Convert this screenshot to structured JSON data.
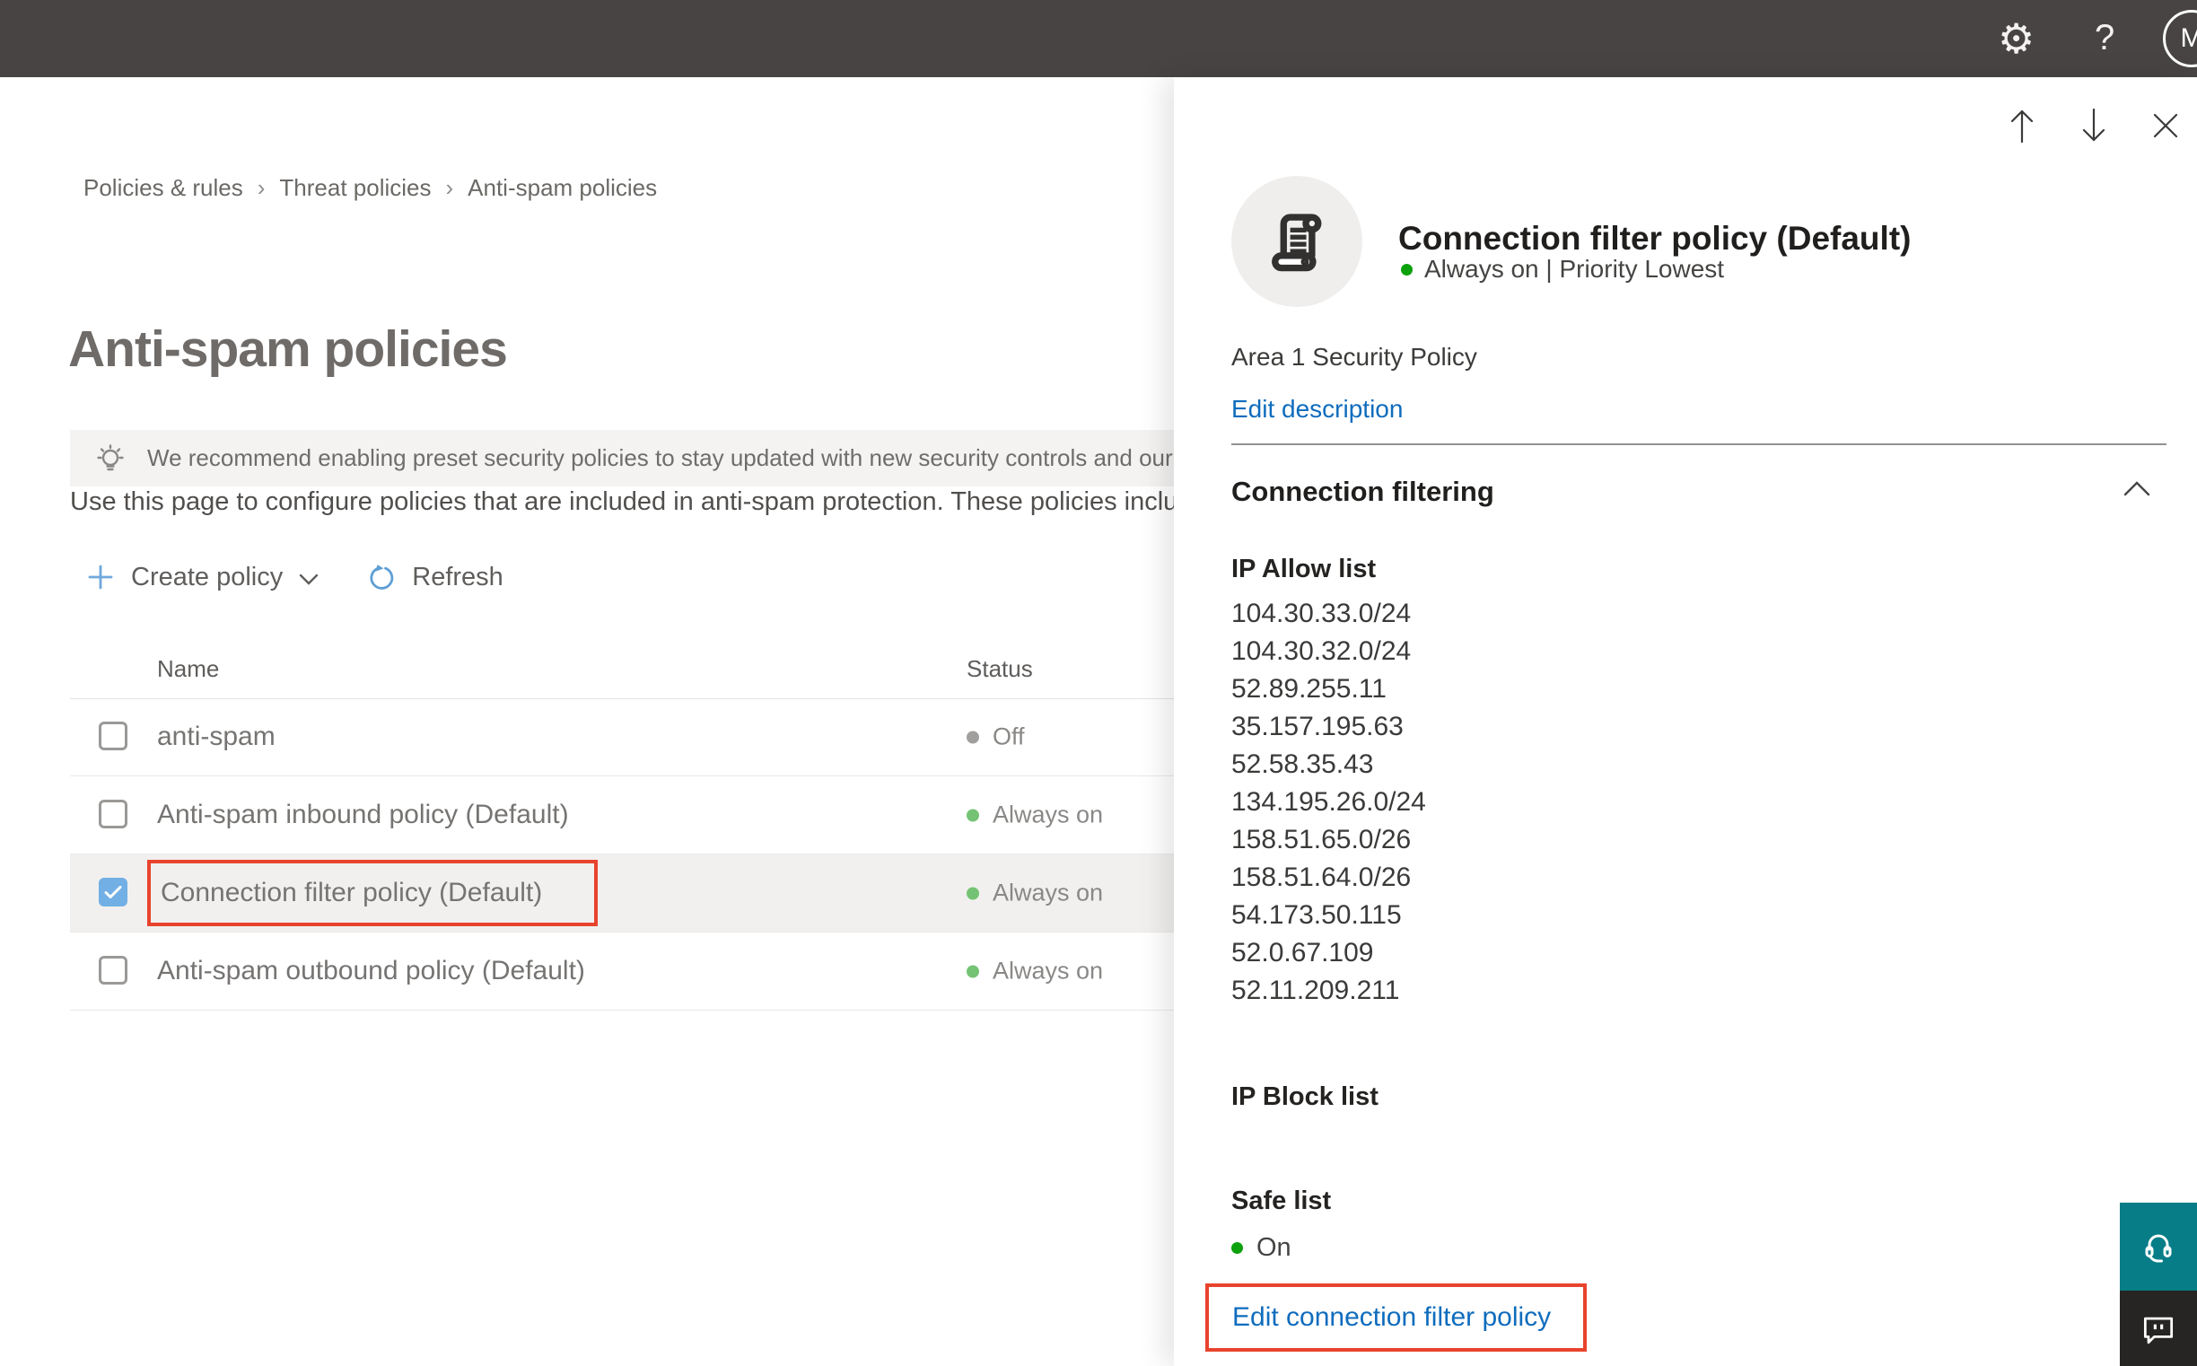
{
  "topbar": {
    "avatar_initial": "M"
  },
  "breadcrumb": {
    "items": [
      "Policies & rules",
      "Threat policies",
      "Anti-spam policies"
    ]
  },
  "page": {
    "title": "Anti-spam policies",
    "banner_text": "We recommend enabling preset security policies to stay updated with new security controls and our recommendations",
    "description": "Use this page to configure policies that are included in anti-spam protection. These policies include"
  },
  "toolbar": {
    "create_policy": "Create policy",
    "refresh": "Refresh"
  },
  "table": {
    "columns": {
      "name": "Name",
      "status": "Status"
    },
    "rows": [
      {
        "name": "anti-spam",
        "status": "Off",
        "checked": false,
        "selected": false
      },
      {
        "name": "Anti-spam inbound policy (Default)",
        "status": "Always on",
        "checked": false,
        "selected": false
      },
      {
        "name": "Connection filter policy (Default)",
        "status": "Always on",
        "checked": true,
        "selected": true
      },
      {
        "name": "Anti-spam outbound policy (Default)",
        "status": "Always on",
        "checked": false,
        "selected": false
      }
    ]
  },
  "flyout": {
    "title": "Connection filter policy (Default)",
    "status_line": "Always on | Priority Lowest",
    "description": "Area 1 Security Policy",
    "edit_description_link": "Edit description",
    "section_title": "Connection filtering",
    "ip_allow_title": "IP Allow list",
    "ip_allow_list": [
      "104.30.33.0/24",
      "104.30.32.0/24",
      "52.89.255.11",
      "35.157.195.63",
      "52.58.35.43",
      "134.195.26.0/24",
      "158.51.65.0/26",
      "158.51.64.0/26",
      "54.173.50.115",
      "52.0.67.109",
      "52.11.209.211"
    ],
    "ip_block_title": "IP Block list",
    "safe_list_title": "Safe list",
    "safe_list_status": "On",
    "edit_policy_link": "Edit connection filter policy"
  },
  "colors": {
    "topbar_bg": "#474443",
    "accent_blue": "#0f6cbd",
    "highlight_red": "#e8432d",
    "status_green_bright": "#0da10d",
    "status_green_soft": "#74c374",
    "status_gray": "#a19f9d",
    "checkbox_checked": "#71afe5",
    "teal_button": "#077d87",
    "feedback_button": "#262524"
  }
}
